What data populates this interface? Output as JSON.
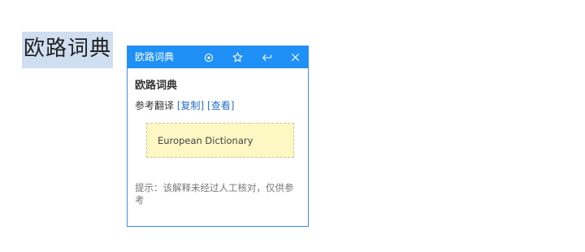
{
  "selection": {
    "text": "欧路词典"
  },
  "popup": {
    "title": "欧路词典",
    "icons": [
      "target-icon",
      "star-icon",
      "back-icon",
      "close-icon"
    ],
    "entry_word": "欧路词典",
    "ref_label": "参考翻译",
    "copy_link": "[复制]",
    "view_link": "[查看]",
    "translation": "European Dictionary",
    "hint": "提示：该解释未经过人工核对，仅供参考"
  },
  "colors": {
    "header": "#1e90f6",
    "selection_highlight": "#cfdef0",
    "translation_bg": "#fdf7c4",
    "link": "#2a6fc4"
  }
}
